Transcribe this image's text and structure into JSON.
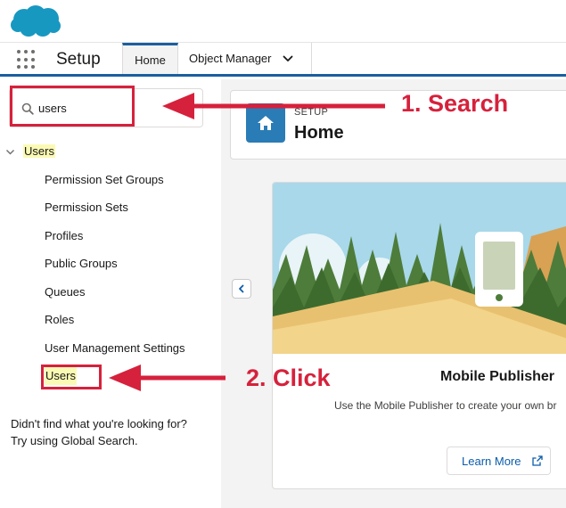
{
  "nav": {
    "app_name": "Setup",
    "tabs": [
      {
        "label": "Home",
        "active": true
      },
      {
        "label": "Object Manager",
        "active": false
      }
    ]
  },
  "sidebar": {
    "search": {
      "value": "users",
      "placeholder": "Quick Find"
    },
    "tree_root": "Users",
    "items": [
      "Permission Set Groups",
      "Permission Sets",
      "Profiles",
      "Public Groups",
      "Queues",
      "Roles",
      "User Management Settings",
      "Users"
    ],
    "not_found_line1": "Didn't find what you're looking for?",
    "not_found_line2": "Try using Global Search."
  },
  "header": {
    "eyebrow": "SETUP",
    "title": "Home"
  },
  "card": {
    "title": "Mobile Publisher",
    "description": "Use the Mobile Publisher to create your own br",
    "button_label": "Learn More"
  },
  "annotations": {
    "step1": "1. Search",
    "step2": "2. Click"
  },
  "colors": {
    "accent": "#1b5f9e",
    "annotation": "#d6213c",
    "highlight": "#fafab4",
    "brand_cloud": "#1798c1"
  }
}
